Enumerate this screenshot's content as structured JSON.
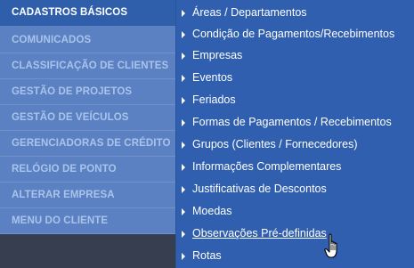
{
  "left_menu": {
    "items": [
      {
        "label": "CADASTROS BÁSICOS",
        "active": true
      },
      {
        "label": "COMUNICADOS"
      },
      {
        "label": "CLASSIFICAÇÃO DE CLIENTES"
      },
      {
        "label": "GESTÃO DE PROJETOS"
      },
      {
        "label": "GESTÃO DE VEÍCULOS"
      },
      {
        "label": "GERENCIADORAS DE CRÉDITO"
      },
      {
        "label": "RELÓGIO DE PONTO"
      },
      {
        "label": "ALTERAR EMPRESA"
      },
      {
        "label": "MENU DO CLIENTE"
      }
    ]
  },
  "submenu": {
    "items": [
      {
        "label": "Áreas / Departamentos"
      },
      {
        "label": "Condição de Pagamentos/Recebimentos"
      },
      {
        "label": "Empresas"
      },
      {
        "label": "Eventos"
      },
      {
        "label": "Feriados"
      },
      {
        "label": "Formas de Pagamentos / Recebimentos"
      },
      {
        "label": "Grupos (Clientes / Fornecedores)"
      },
      {
        "label": "Informações Complementares"
      },
      {
        "label": "Justificativas de Descontos"
      },
      {
        "label": "Moedas"
      },
      {
        "label": "Observações Pré-definidas",
        "hovered": true
      },
      {
        "label": "Rotas"
      }
    ]
  },
  "icons": {
    "submenu_arrow": "triangle-right-icon",
    "pointer": "hand-pointer-icon"
  },
  "colors": {
    "left_bg": "#5b81c3",
    "left_active_bg": "#2f5faa",
    "left_text": "#a9c4ea",
    "submenu_bg": "#2f5fae",
    "submenu_text": "#ffffff"
  }
}
